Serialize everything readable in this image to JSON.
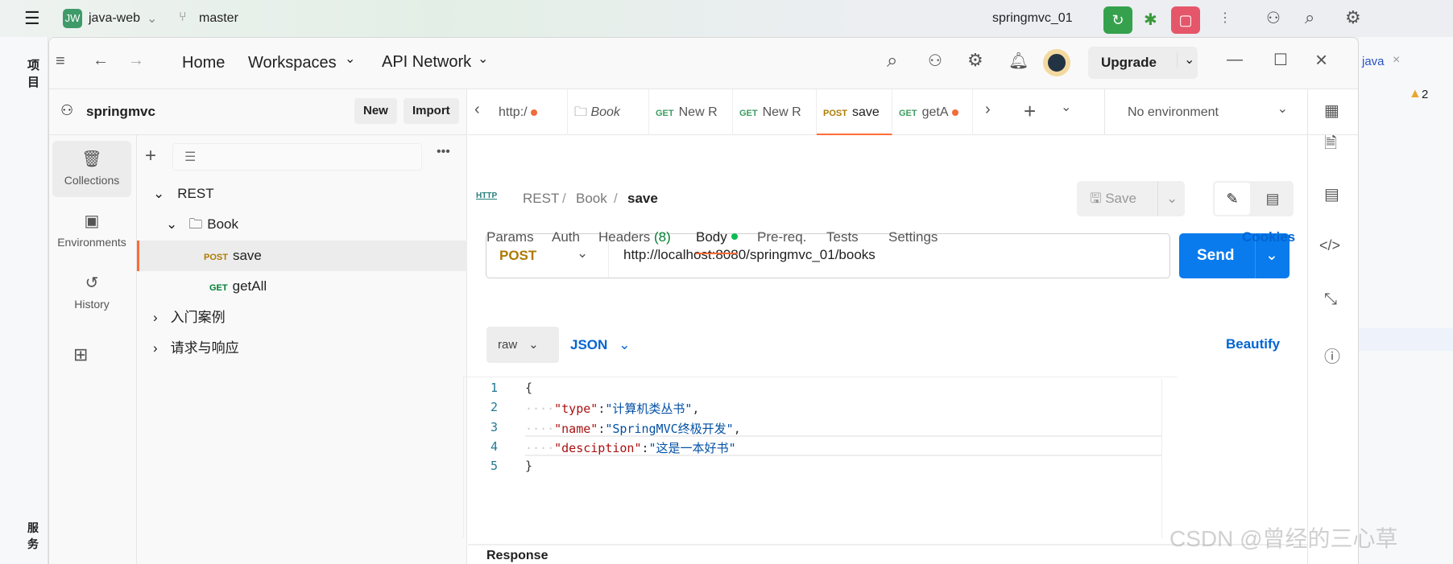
{
  "ide": {
    "project_badge": "JW",
    "project": "java-web",
    "branch": "master",
    "run_config": "springmvc_01",
    "left_label": "项目",
    "bottom_label": "服务",
    "open_file": "java",
    "warnings": "2"
  },
  "header": {
    "home": "Home",
    "workspaces": "Workspaces",
    "api_network": "API Network",
    "upgrade": "Upgrade"
  },
  "workspace": {
    "name": "springmvc",
    "new": "New",
    "import": "Import"
  },
  "rail": [
    {
      "label": "Collections",
      "active": true
    },
    {
      "label": "Environments"
    },
    {
      "label": "History"
    }
  ],
  "tree": {
    "rest": "REST",
    "book": "Book",
    "items": [
      {
        "method": "POST",
        "name": "save",
        "active": true
      },
      {
        "method": "GET",
        "name": "getAll"
      }
    ],
    "collections": [
      "入门案例",
      "请求与响应"
    ]
  },
  "tabs": [
    {
      "label": "http:/",
      "dot": true
    },
    {
      "label": "Book"
    },
    {
      "method": "GET",
      "label": "New R"
    },
    {
      "method": "GET",
      "label": "New R"
    },
    {
      "method": "POST",
      "label": "save",
      "active": true
    },
    {
      "method": "GET",
      "label": "getA",
      "dot": true
    }
  ],
  "environment": "No environment",
  "breadcrumb": {
    "icon": "HTTP",
    "parts": [
      "REST",
      "Book"
    ],
    "current": "save",
    "save": "Save"
  },
  "request": {
    "method": "POST",
    "url": "http://localhost:8080/springmvc_01/books",
    "send": "Send"
  },
  "req_tabs": {
    "params": "Params",
    "auth": "Auth",
    "headers": "Headers",
    "headers_count": "(8)",
    "body": "Body",
    "prereq": "Pre-req.",
    "tests": "Tests",
    "settings": "Settings",
    "cookies": "Cookies"
  },
  "body": {
    "mode": "raw",
    "format": "JSON",
    "beautify": "Beautify",
    "lines": [
      {
        "n": "1",
        "p1": "{"
      },
      {
        "n": "2",
        "k": "\"type\"",
        "s": "\"计算机类丛书\"",
        "p2": ","
      },
      {
        "n": "3",
        "k": "\"name\"",
        "s": "\"SpringMVC终极开发\"",
        "p2": ","
      },
      {
        "n": "4",
        "k": "\"desciption\"",
        "s": "\"这是一本好书\"",
        "p2": ""
      },
      {
        "n": "5",
        "p1": "}"
      }
    ]
  },
  "response": "Response",
  "watermark": "CSDN @曾经的三心草",
  "colors": {
    "accent": "#ff6c37",
    "send": "#097bed",
    "post": "#ad7a03",
    "get": "#007f31",
    "link": "#0265d2"
  }
}
